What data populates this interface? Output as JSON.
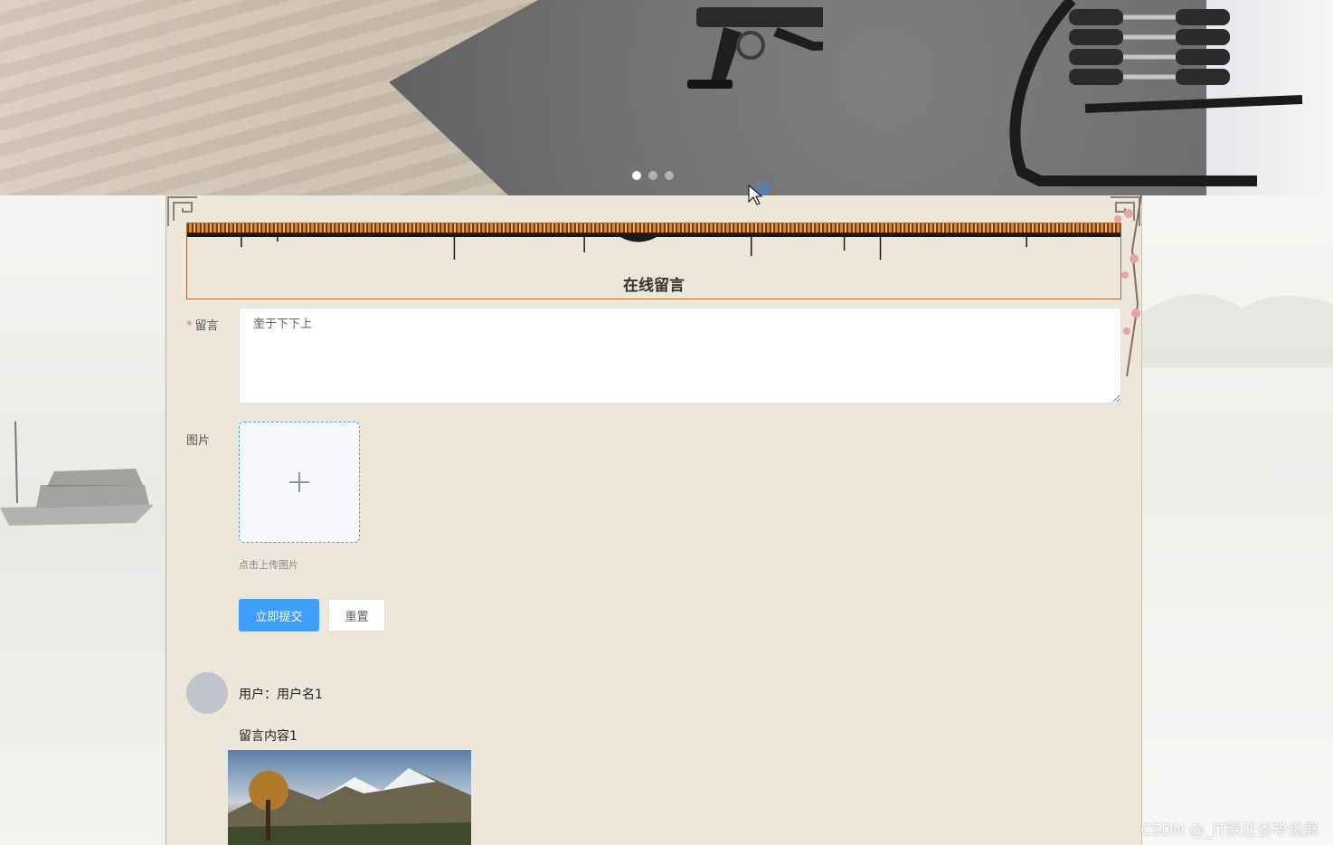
{
  "banner": {
    "slide_count": 3,
    "active_slide": 1
  },
  "form": {
    "title": "在线留言",
    "message_label": "留言",
    "message_value": "奎于下下上",
    "image_label": "图片",
    "upload_tip": "点击上传图片",
    "submit_label": "立即提交",
    "reset_label": "重置"
  },
  "comments": [
    {
      "user": "用户：用户名1",
      "content": "留言内容1"
    }
  ],
  "watermark": "CSDN @_IT跃迁谷毕设展",
  "colors": {
    "primary": "#409eff",
    "panel_bg": "#ede6da",
    "required": "#f56c6c"
  }
}
